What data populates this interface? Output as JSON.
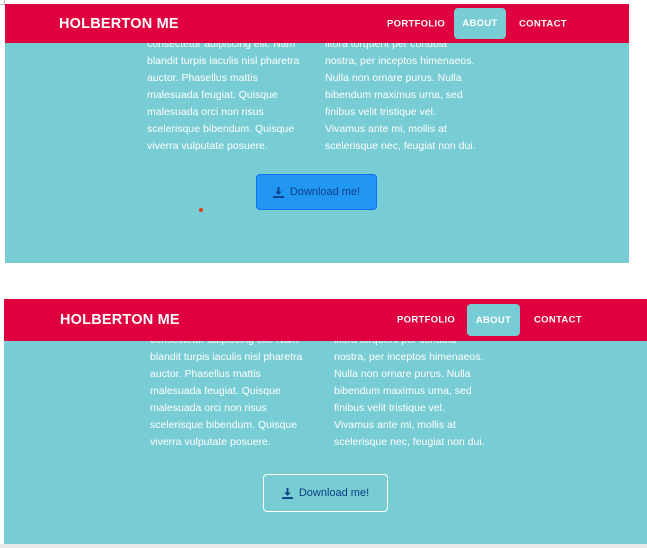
{
  "brand": "HOLBERTON ME",
  "menu": {
    "portfolio": "PORTFOLIO",
    "about": "ABOUT",
    "contact": "CONTACT"
  },
  "col_left": [
    "consectetur adipiscing elit. Nam",
    "blandit turpis iaculis nisl pharetra",
    "auctor. Phasellus mattis",
    "malesuada feugiat. Quisque",
    "malesuada orci non risus",
    "scelerisque bibendum. Quisque",
    "viverra vulputate posuere."
  ],
  "col_right": [
    "litora torquent per conubia",
    "nostra, per inceptos himenaeos.",
    "Nulla non ornare purus. Nulla",
    "bibendum maximus urna, sed",
    "finibus velit tristique vel.",
    "Vivamus ante mi, mollis at",
    "scelerisque nec, feugiat non dui."
  ],
  "download_label": "Download me!",
  "icons": {
    "download": "download-icon"
  },
  "colors": {
    "navbar": "#e0003f",
    "section_bg": "#78ccd3",
    "text": "#ffffff",
    "button_hover_bg": "#2196f3",
    "button_text": "#0c3f86"
  }
}
